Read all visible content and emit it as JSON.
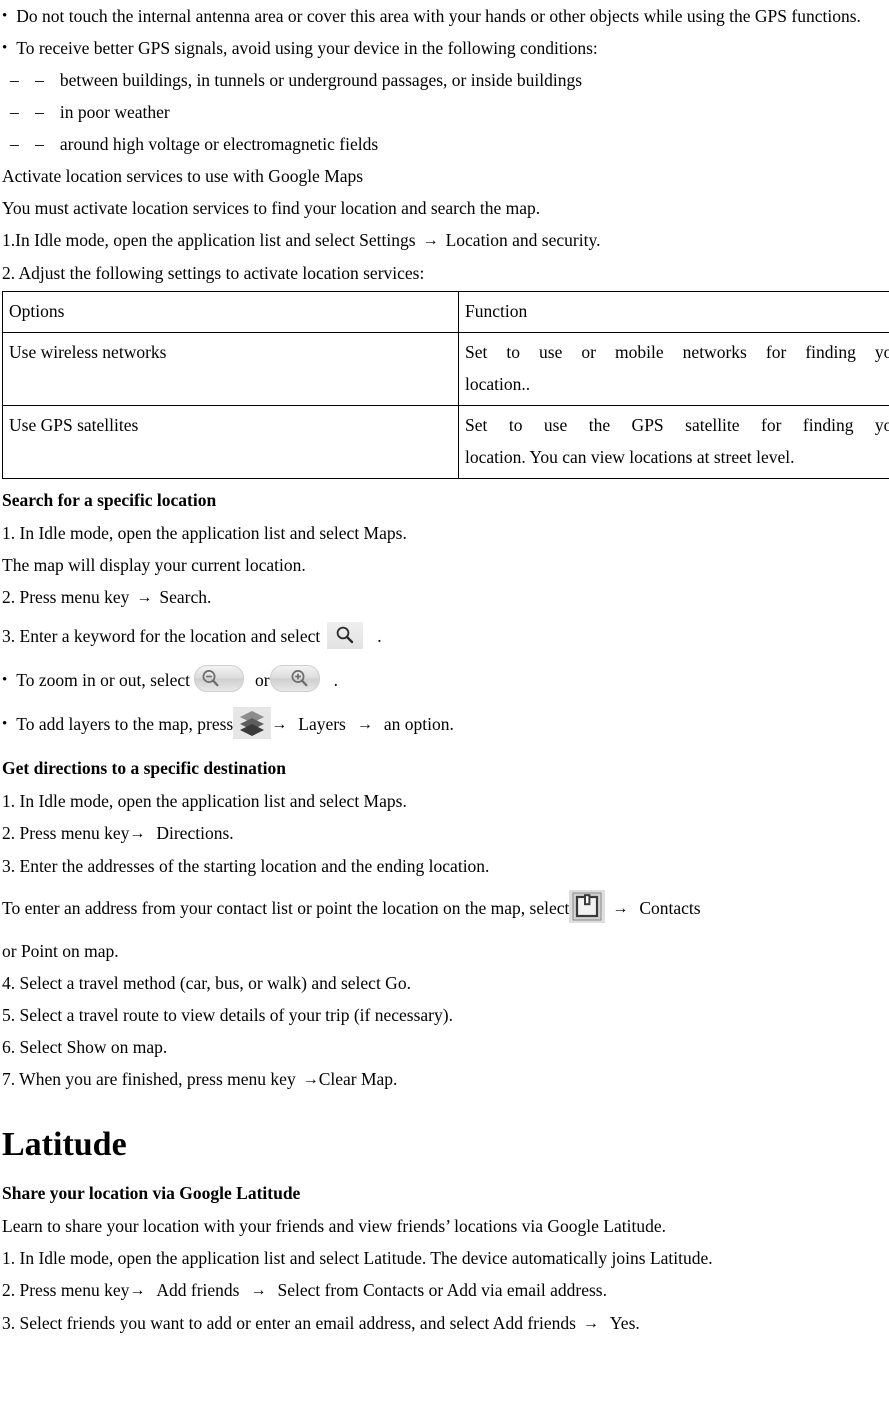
{
  "gps_tips": {
    "bullets": [
      "Do not touch the internal antenna area or cover this area with your hands or other objects while using the GPS functions.",
      "To receive better GPS signals, avoid using your device in the following conditions:"
    ],
    "sub_items": [
      "between buildings, in tunnels or underground passages, or inside buildings",
      "in poor weather",
      "around high voltage or electromagnetic fields"
    ]
  },
  "activate": {
    "heading": "Activate location services to use with Google Maps",
    "intro": "You must activate location services to find your location and search the map.",
    "step1_before": "1.In Idle mode, open the application list and select Settings",
    "step1_after": "Location and security.",
    "step2": "2. Adjust the following settings to activate location services:",
    "table": {
      "headers": [
        "Options",
        "Function"
      ],
      "rows": [
        {
          "option": "Use wireless networks",
          "function_line1": "Set to use or mobile networks for finding your",
          "function_line2": "location.."
        },
        {
          "option": "Use GPS satellites",
          "function_line1": "Set to use the GPS satellite for finding your",
          "function_line2": "location. You can view locations at street level."
        }
      ]
    }
  },
  "search_location": {
    "heading": "Search for a specific location",
    "step1": "1. In Idle mode, open the application list and select Maps.",
    "note": "The map will display your current location.",
    "step2_before": "2. Press menu key",
    "step2_after": "Search.",
    "step3_before": "3. Enter a keyword for the location and select",
    "step3_after": ".",
    "bullet_zoom_before": "To zoom in or out, select",
    "bullet_zoom_mid": "or",
    "bullet_zoom_after": ".",
    "bullet_layers_before": "To add layers to the map, press",
    "bullet_layers_mid": "Layers",
    "bullet_layers_after": "an option."
  },
  "directions": {
    "heading": "Get directions to a specific destination",
    "step1": "1. In Idle mode, open the application list and select Maps.",
    "step2_before": "2. Press menu key",
    "step2_after": "Directions.",
    "step3": "3. Enter the addresses of the starting location and the ending location.",
    "contact_before": "To enter an address from your contact list or point the location on the map, select",
    "contact_after": "Contacts",
    "contact_line2": "or Point on map.",
    "step4": "4. Select a travel method (car, bus, or walk) and select Go.",
    "step5": "5. Select a travel route to view details of your trip (if necessary).",
    "step6": "6. Select Show on map.",
    "step7_before": "7. When you are finished, press menu key",
    "step7_after": "Clear Map."
  },
  "latitude": {
    "chapter_title": "Latitude",
    "heading": "Share your location via Google Latitude",
    "intro": "Learn to share your location with your friends and view friends’ locations via Google Latitude.",
    "step1": "1. In Idle mode, open the application list and select Latitude. The device automatically joins Latitude.",
    "step2_before": "2. Press menu key",
    "step2_mid": "Add friends",
    "step2_after": "Select from Contacts or Add via email address.",
    "step3_before": "3. Select friends you want to add or enter an email address, and select Add friends",
    "step3_after": "Yes."
  },
  "glyphs": {
    "bullet": "•",
    "dash": "– –",
    "arrow": "→"
  },
  "icons": {
    "search": "search-icon",
    "zoom_out": "zoom-out-icon",
    "zoom_in": "zoom-in-icon",
    "layers": "layers-icon",
    "contacts": "contacts-icon"
  }
}
